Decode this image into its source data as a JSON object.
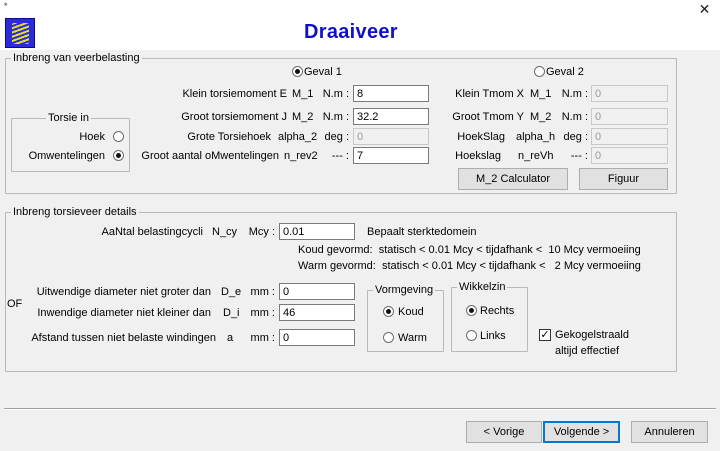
{
  "window": {
    "title_mark": "*",
    "close": "✕"
  },
  "app": {
    "title": "Draaiveer"
  },
  "load_group": {
    "legend": "Inbreng van veerbelasting",
    "case1_label": "Geval 1",
    "case2_label": "Geval 2",
    "torsion_in": {
      "legend": "Torsie in",
      "angle_label": "Hoek",
      "revolutions_label": "Omwentelingen"
    },
    "rows_left": [
      {
        "label": "Klein torsiemoment E",
        "symbol": "M_1",
        "unit": "N.m :",
        "value": "8"
      },
      {
        "label": "Groot torsiemoment J",
        "symbol": "M_2",
        "unit": "N.m :",
        "value": "32.2"
      },
      {
        "label": "Grote Torsiehoek",
        "symbol": "alpha_2",
        "unit": "deg :",
        "value": "0"
      },
      {
        "label": "Groot aantal oMwentelingen",
        "symbol": "n_rev2",
        "unit": "--- :",
        "value": "7"
      }
    ],
    "rows_right": [
      {
        "label": "Klein Tmom X",
        "symbol": "M_1",
        "unit": "N.m :",
        "value": "0"
      },
      {
        "label": "Groot Tmom Y",
        "symbol": "M_2",
        "unit": "N.m :",
        "value": "0"
      },
      {
        "label": "HoekSlag",
        "symbol": "alpha_h",
        "unit": "deg :",
        "value": "0"
      },
      {
        "label": "Hoekslag",
        "symbol": "n_reVh",
        "unit": "--- :",
        "value": "0"
      }
    ],
    "calc_button": "M_2 Calculator",
    "figure_button": "Figuur"
  },
  "details_group": {
    "legend": "Inbreng torsieveer details",
    "cycles": {
      "label": "AaNtal belastingcycli",
      "symbol": "N_cy",
      "unit": "Mcy :",
      "value": "0.01",
      "note": "Bepaalt sterktedomein"
    },
    "cold_line": "Koud gevormd:  statisch < 0.01 Mcy < tijdafhank <  10 Mcy vermoeiing",
    "warm_line": "Warm gevormd:  statisch < 0.01 Mcy < tijdafhank <   2 Mcy vermoeiing",
    "or_label": "OF",
    "outer_diameter": {
      "label": "Uitwendige diameter niet groter dan",
      "symbol": "D_e",
      "unit": "mm :",
      "value": "0"
    },
    "inner_diameter": {
      "label": "Inwendige diameter niet kleiner dan",
      "symbol": "D_i",
      "unit": "mm :",
      "value": "46"
    },
    "gap": {
      "label": "Afstand tussen niet belaste windingen",
      "symbol": "a",
      "unit": "mm :",
      "value": "0"
    },
    "forming": {
      "legend": "Vormgeving",
      "cold": "Koud",
      "warm": "Warm"
    },
    "winding": {
      "legend": "Wikkelzin",
      "right": "Rechts",
      "left": "Links"
    },
    "shot_peened_line1": "Gekogelstraald",
    "shot_peened_line2": "altijd effectief"
  },
  "footer": {
    "prev": "< Vorige",
    "next": "Volgende >",
    "cancel": "Annuleren"
  }
}
